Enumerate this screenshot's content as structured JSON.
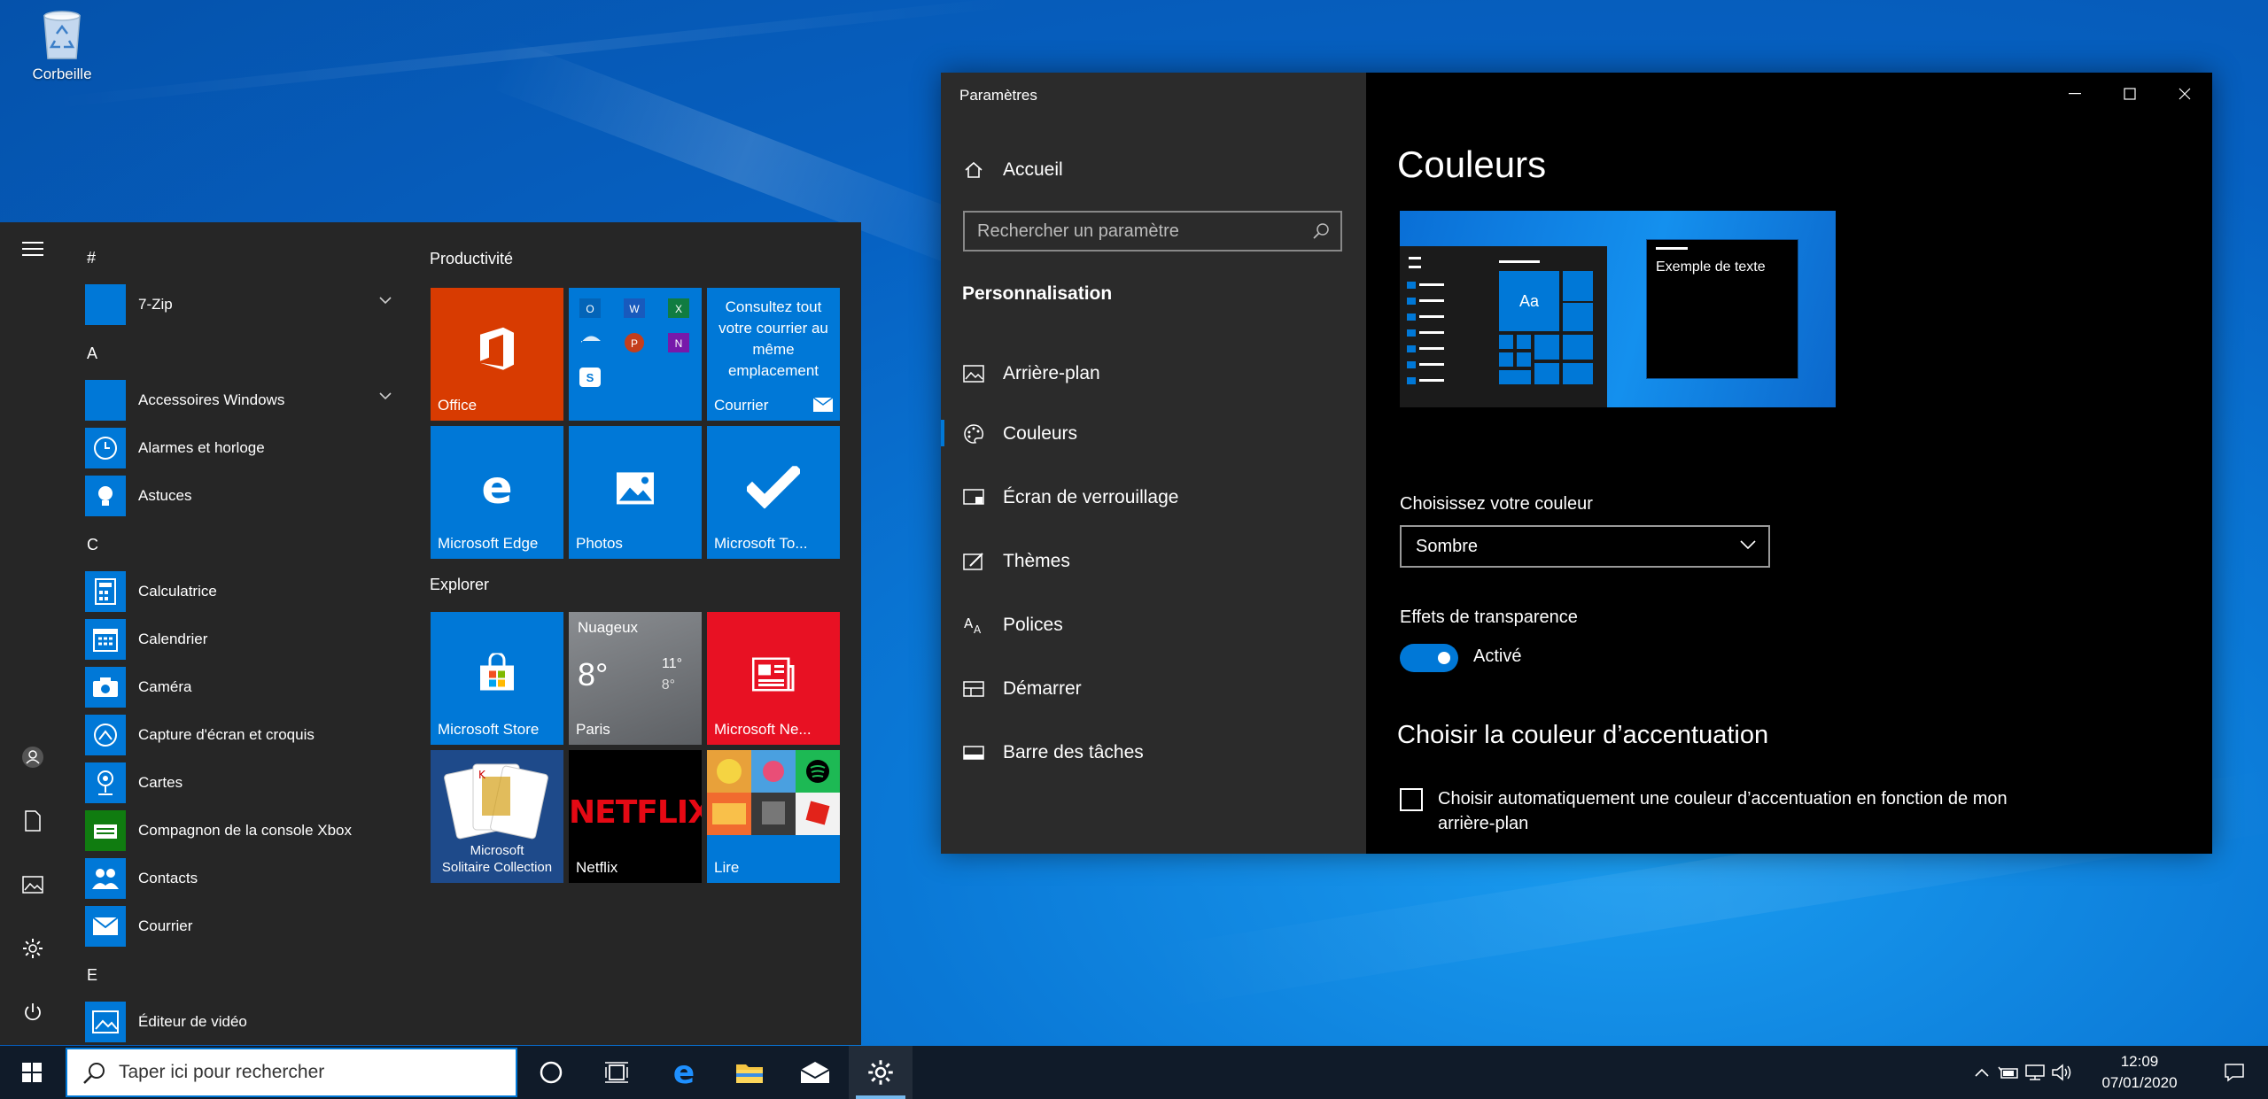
{
  "desktop": {
    "recycle_bin_label": "Corbeille"
  },
  "start_menu": {
    "app_list": {
      "sections": [
        {
          "letter": "#",
          "apps": [
            {
              "label": "7-Zip",
              "icon": "folder-icon",
              "expandable": true
            }
          ]
        },
        {
          "letter": "A",
          "apps": [
            {
              "label": "Accessoires Windows",
              "icon": "folder-icon",
              "expandable": true
            },
            {
              "label": "Alarmes et horloge",
              "icon": "clock-icon"
            },
            {
              "label": "Astuces",
              "icon": "lightbulb-icon"
            }
          ]
        },
        {
          "letter": "C",
          "apps": [
            {
              "label": "Calculatrice",
              "icon": "calculator-icon"
            },
            {
              "label": "Calendrier",
              "icon": "calendar-icon"
            },
            {
              "label": "Caméra",
              "icon": "camera-icon"
            },
            {
              "label": "Capture d'écran et croquis",
              "icon": "snip-icon"
            },
            {
              "label": "Cartes",
              "icon": "map-pin-icon"
            },
            {
              "label": "Compagnon de la console Xbox",
              "icon": "xbox-icon"
            },
            {
              "label": "Contacts",
              "icon": "people-icon"
            },
            {
              "label": "Courrier",
              "icon": "mail-icon"
            }
          ]
        },
        {
          "letter": "E",
          "apps": [
            {
              "label": "Éditeur de vidéo",
              "icon": "video-editor-icon"
            }
          ]
        }
      ]
    },
    "tile_groups": [
      {
        "title": "Productivité",
        "tiles": [
          {
            "label": "Office",
            "color": "#d83b01"
          },
          {
            "label": "",
            "color": "#0078d7"
          },
          {
            "label": "Courrier",
            "color": "#0078d7",
            "text": "Consultez tout votre courrier au même emplacement"
          },
          {
            "label": "Microsoft Edge",
            "color": "#0078d7"
          },
          {
            "label": "Photos",
            "color": "#0078d7"
          },
          {
            "label": "Microsoft To...",
            "color": "#0078d7"
          }
        ]
      },
      {
        "title": "Explorer",
        "tiles": [
          {
            "label": "Microsoft Store",
            "color": "#0078d7"
          },
          {
            "label": "Paris",
            "color": "#6b6e72",
            "weather": {
              "condition": "Nuageux",
              "temp": "8°",
              "high": "11°",
              "low": "8°"
            }
          },
          {
            "label": "Microsoft Ne...",
            "color": "#e81123"
          },
          {
            "label": "Microsoft\nSolitaire Collection",
            "color": "#1e4a8a"
          },
          {
            "label": "Netflix",
            "color": "#000000",
            "logo": "NETFLIX"
          },
          {
            "label": "Lire",
            "color": "#0078d7"
          }
        ]
      }
    ]
  },
  "settings": {
    "window_title": "Paramètres",
    "nav": {
      "home": "Accueil",
      "search_placeholder": "Rechercher un paramètre",
      "section": "Personnalisation",
      "items": [
        "Arrière-plan",
        "Couleurs",
        "Écran de verrouillage",
        "Thèmes",
        "Polices",
        "Démarrer",
        "Barre des tâches"
      ],
      "selected_index": 1
    },
    "content": {
      "title": "Couleurs",
      "preview_sample_text": "Exemple de texte",
      "preview_tile_text": "Aa",
      "color_label": "Choisissez votre couleur",
      "color_value": "Sombre",
      "transparency_label": "Effets de transparence",
      "transparency_value": "Activé",
      "accent_heading": "Choisir la couleur d’accentuation",
      "auto_accent_text": "Choisir automatiquement une couleur d’accentuation en fonction de mon arrière-plan",
      "auto_accent_checked": false
    }
  },
  "taskbar": {
    "search_placeholder": "Taper ici pour rechercher",
    "time": "12:09",
    "date": "07/01/2020"
  },
  "colors": {
    "accent": "#0078d7",
    "settings_sidebar": "#2b2b2b",
    "start_bg": "#262626",
    "taskbar": "#101b29"
  }
}
